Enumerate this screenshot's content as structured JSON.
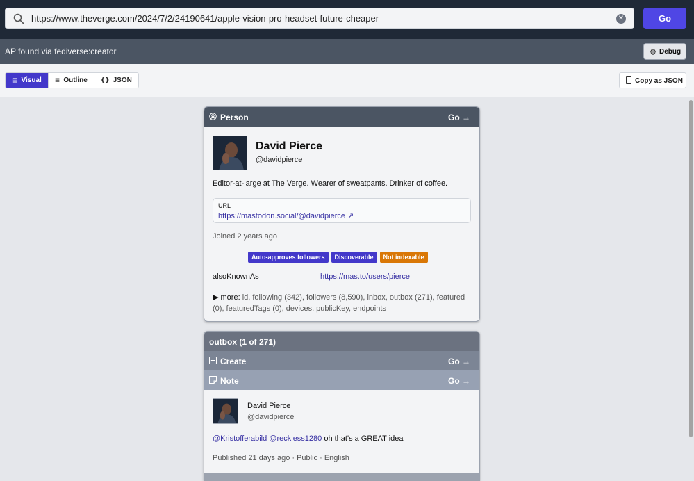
{
  "url_bar": {
    "value": "https://www.theverge.com/2024/7/2/24190641/apple-vision-pro-headset-future-cheaper",
    "go_label": "Go"
  },
  "status": {
    "text": "AP found via fediverse:creator",
    "debug_label": "Debug"
  },
  "view_tabs": [
    {
      "label": "Visual",
      "icon": "card-icon",
      "active": true
    },
    {
      "label": "Outline",
      "icon": "list-icon",
      "active": false
    },
    {
      "label": "JSON",
      "icon": "braces-icon",
      "active": false
    }
  ],
  "copy_label": "Copy as JSON",
  "person_card": {
    "type_label": "Person",
    "go_label": "Go →",
    "name": "David Pierce",
    "handle": "@davidpierce",
    "bio": "Editor-at-large at The Verge. Wearer of sweatpants. Drinker of coffee.",
    "url_key": "URL",
    "url_value": "https://mastodon.social/@davidpierce ↗",
    "joined": "Joined 2 years ago",
    "badges": [
      {
        "label": "Auto-approves followers",
        "color": "#4338ca"
      },
      {
        "label": "Discoverable",
        "color": "#4338ca"
      },
      {
        "label": "Not indexable",
        "color": "#d97706"
      }
    ],
    "also_known_as_key": "alsoKnownAs",
    "also_known_as_value": "https://mas.to/users/pierce",
    "more_key": "▶ more:",
    "more_value": " id, following (342), followers (8,590), inbox, outbox (271), featured (0), featuredTags (0), devices, publicKey, endpoints"
  },
  "outbox_card": {
    "title": "outbox (1 of 271)",
    "create_label": "Create",
    "note_label": "Note",
    "go_label": "Go →",
    "note": {
      "author_name": "David Pierce",
      "author_handle": "@davidpierce",
      "mention_1": "@Kristofferabild",
      "mention_2": "@reckless1280",
      "text": " oh that's a GREAT idea",
      "meta": "Published 21 days ago · Public · English"
    }
  },
  "colors": {
    "accent": "#4f46e5",
    "header_dark": "#4b5563",
    "link": "#3730a3"
  }
}
